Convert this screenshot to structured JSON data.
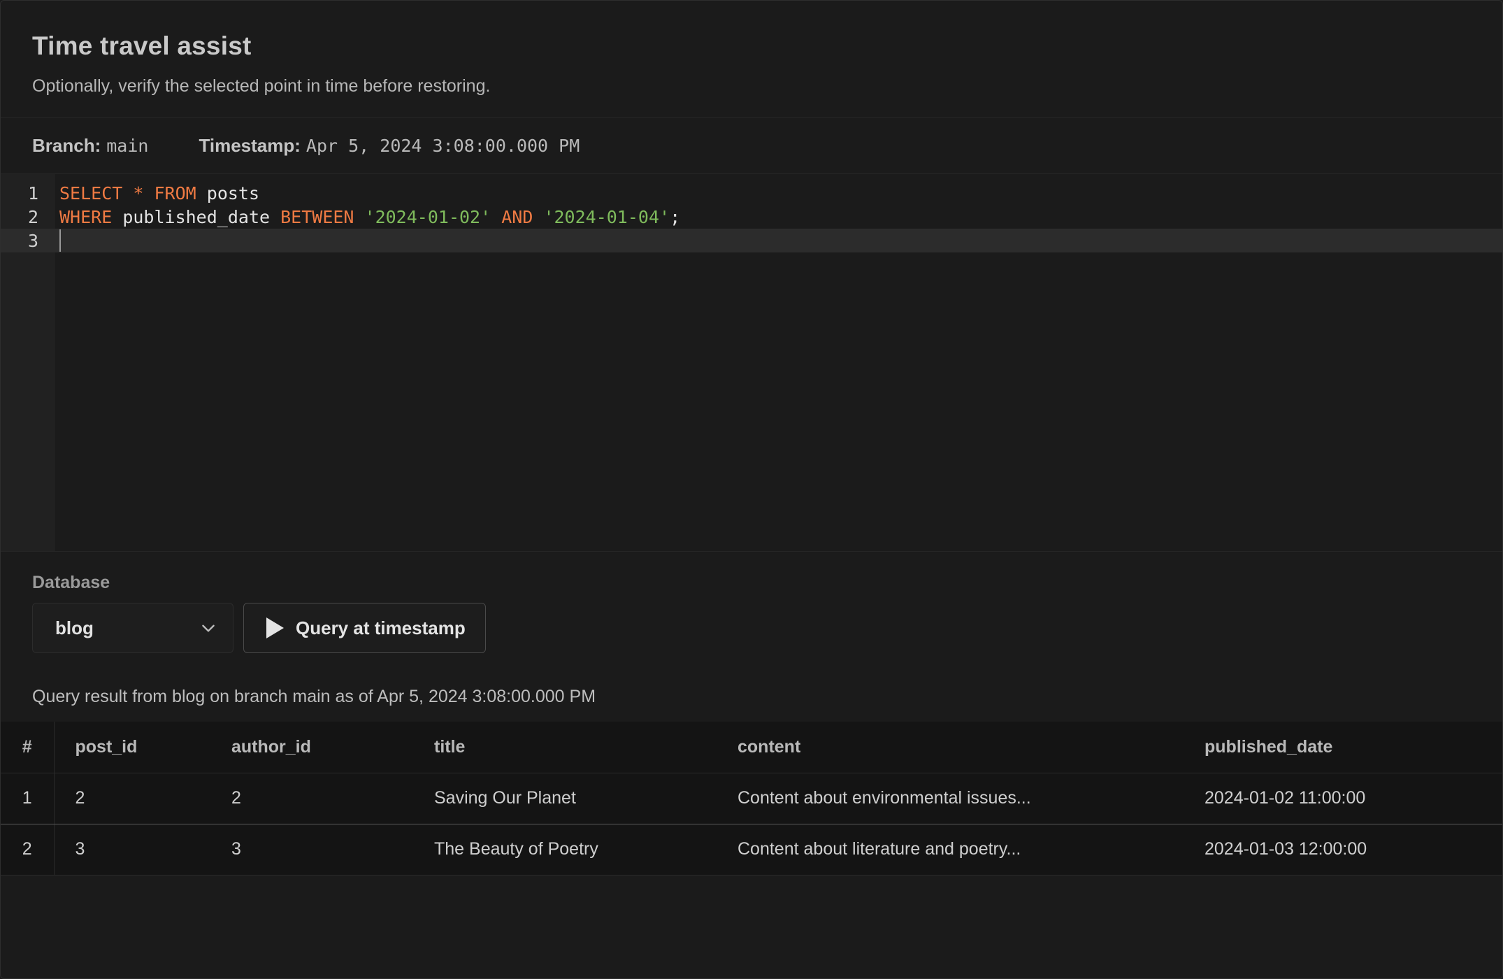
{
  "dialog": {
    "title": "Time travel assist",
    "subtitle": "Optionally, verify the selected point in time before restoring."
  },
  "meta": {
    "branch_label": "Branch:",
    "branch_value": "main",
    "timestamp_label": "Timestamp:",
    "timestamp_value": "Apr 5, 2024 3:08:00.000 PM"
  },
  "editor": {
    "line_numbers": [
      "1",
      "2",
      "3"
    ],
    "line1": {
      "kw1": "SELECT",
      "op": "*",
      "kw2": "FROM",
      "table": "posts"
    },
    "line2": {
      "kw1": "WHERE",
      "column": "published_date",
      "kw2": "BETWEEN",
      "str1": "'2024-01-02'",
      "kw3": "AND",
      "str2": "'2024-01-04'",
      "end": ";"
    },
    "active_line": 3
  },
  "controls": {
    "database_label": "Database",
    "database_selected": "blog",
    "query_button": "Query at timestamp"
  },
  "result": {
    "caption": "Query result from blog on branch main as of Apr 5, 2024 3:08:00.000 PM",
    "columns": [
      "#",
      "post_id",
      "author_id",
      "title",
      "content",
      "published_date"
    ],
    "rows": [
      [
        "1",
        "2",
        "2",
        "Saving Our Planet",
        "Content about environmental issues...",
        "2024-01-02 11:00:00"
      ],
      [
        "2",
        "3",
        "3",
        "The Beauty of Poetry",
        "Content about literature and poetry...",
        "2024-01-03 12:00:00"
      ]
    ]
  },
  "colors": {
    "background": "#1b1b1b",
    "keyword": "#ef7a43",
    "string": "#7fbb5c",
    "table_bg": "#141414"
  }
}
